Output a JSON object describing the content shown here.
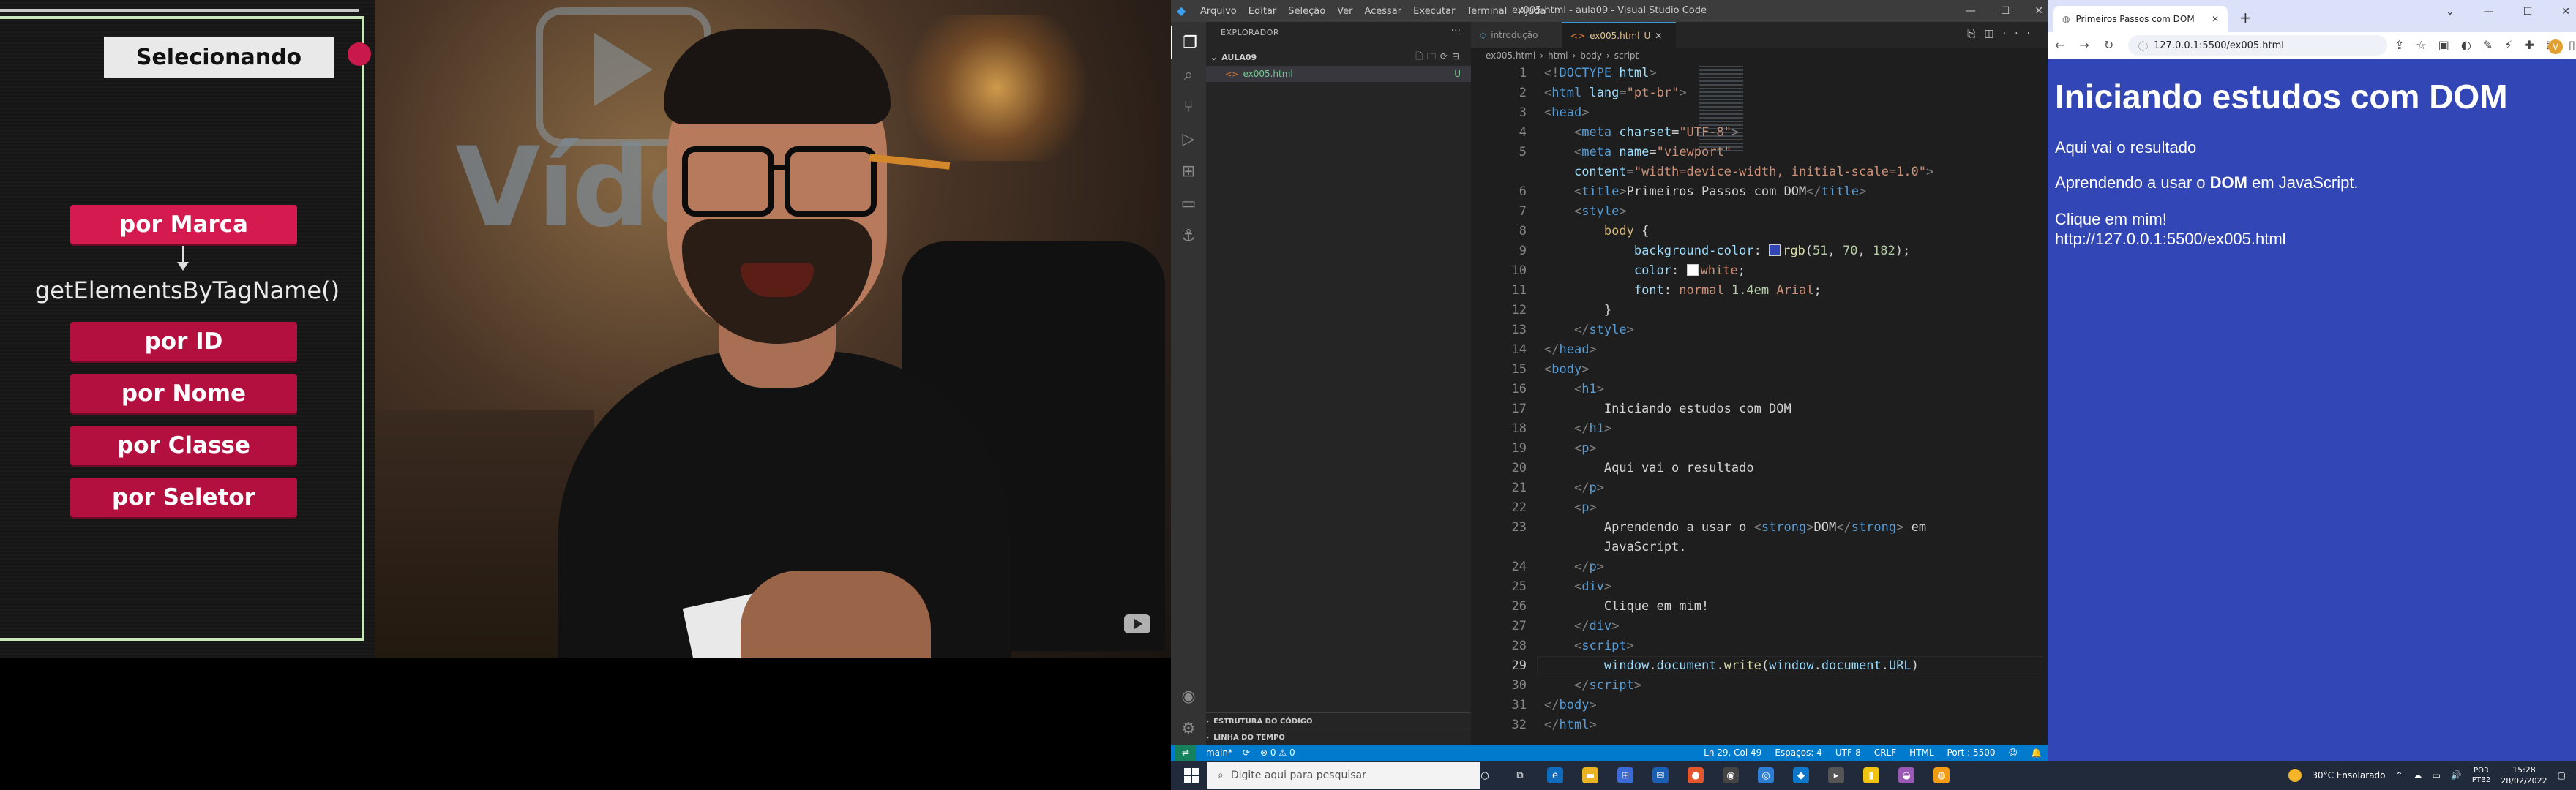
{
  "slide": {
    "title": "Selecionando",
    "buttons": [
      "por Marca",
      "por ID",
      "por Nome",
      "por Classe",
      "por Seletor"
    ],
    "method": "getElementsByTagName()"
  },
  "camera": {
    "bg_text": "Vídeo"
  },
  "vscode": {
    "menu": [
      "Arquivo",
      "Editar",
      "Seleção",
      "Ver",
      "Acessar",
      "Executar",
      "Terminal",
      "Ajuda"
    ],
    "title": "ex005.html - aula09 - Visual Studio Code",
    "explorer_label": "EXPLORADOR",
    "folder": "AULA09",
    "file": "ex005.html",
    "file_status": "U",
    "section_outline": "ESTRUTURA DO CÓDIGO",
    "section_timeline": "LINHA DO TEMPO",
    "tab1": "introdução",
    "tab2": "ex005.html",
    "tab2_status": "U",
    "breadcrumb": [
      "ex005.html",
      "html",
      "body",
      "script"
    ],
    "line_numbers": [
      "1",
      "2",
      "3",
      "4",
      "5",
      "",
      "6",
      "7",
      "8",
      "9",
      "10",
      "11",
      "12",
      "13",
      "14",
      "15",
      "16",
      "17",
      "18",
      "19",
      "20",
      "21",
      "22",
      "23",
      "",
      "24",
      "25",
      "26",
      "27",
      "28",
      "29",
      "30",
      "31",
      "32"
    ],
    "status": {
      "branch": "main*",
      "sync": "⟳",
      "problems": "⊗ 0 ⚠ 0",
      "position": "Ln 29, Col 49",
      "spaces": "Espaços: 4",
      "encoding": "UTF-8",
      "eol": "CRLF",
      "language": "HTML",
      "port": "Port : 5500"
    }
  },
  "browser": {
    "tab_title": "Primeiros Passos com DOM",
    "url": "127.0.0.1:5500/ex005.html",
    "page_bg": "#3346b6",
    "h1": "Iniciando estudos com DOM",
    "p1": "Aqui vai o resultado",
    "p2_before": "Aprendendo a usar o ",
    "p2_strong": "DOM",
    "p2_after": " em JavaScript.",
    "div": "Clique em mim!",
    "written_url": "http://127.0.0.1:5500/ex005.html"
  },
  "taskbar": {
    "search": "Digite aqui para pesquisar",
    "weather": "30°C  Ensolarado",
    "lang1": "POR",
    "lang2": "PTB2",
    "time": "15:28",
    "date": "28/02/2022"
  }
}
